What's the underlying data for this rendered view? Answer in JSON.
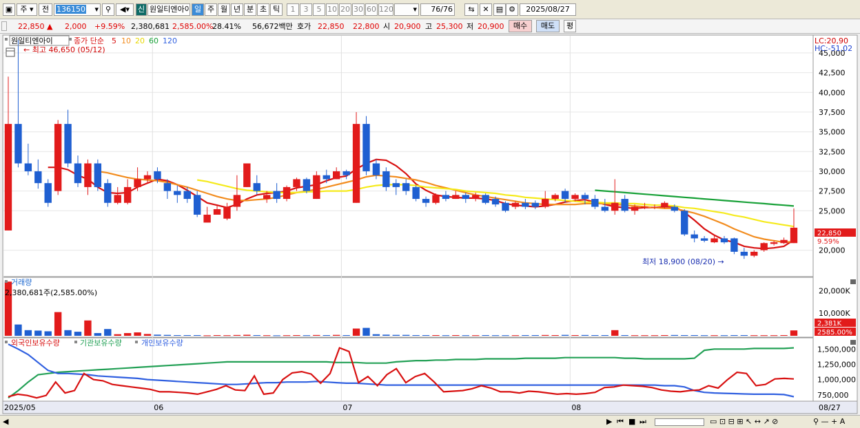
{
  "toolbar": {
    "period_type": "주",
    "prev_label": "전",
    "code": "136150",
    "badge_label": "신",
    "stock_name": "원일티엔아이",
    "periods": [
      "일",
      "주",
      "월",
      "년",
      "분",
      "초",
      "틱"
    ],
    "active_period": "일",
    "intervals": [
      "1",
      "3",
      "5",
      "10",
      "20",
      "30",
      "60",
      "120"
    ],
    "count": "76",
    "count_total": "/76",
    "date": "2025/08/27"
  },
  "quote": {
    "price": "22,850",
    "change": "2,000",
    "change_pct": "+9.59%",
    "volume": "2,380,681",
    "volume_pct": "2,585.00%",
    "turnover_pct": "28.41%",
    "amount": "56,672백만",
    "hoga_label": "호가",
    "ask": "22,850",
    "bid": "22,800",
    "open_label": "시",
    "open": "20,900",
    "high_label": "고",
    "high": "25,300",
    "low_label": "저",
    "low": "20,900",
    "buy_label": "매수",
    "sell_label": "매도",
    "avg_label": "평"
  },
  "price_panel": {
    "legend_name": "원일티엔아이",
    "ma_label": "종가 단순",
    "ma_periods": [
      "5",
      "10",
      "20",
      "60",
      "120"
    ],
    "max_note": "최고 46,650 (05/12)",
    "min_note": "최저 18,900 (08/20)",
    "lc": "LC:20,90",
    "hc": "HC:-51,02",
    "last_price_tag": "22,850",
    "last_pct_tag": "9.59%",
    "y_ticks": [
      "45,000",
      "42,500",
      "40,000",
      "37,500",
      "35,000",
      "32,500",
      "30,000",
      "27,500",
      "25,000",
      "20,000"
    ]
  },
  "volume_panel": {
    "title": "거래량",
    "info": "2,380,681주(2,585.00%)",
    "y_ticks": [
      "20,000K",
      "10,000K"
    ],
    "last_tag": "2,381K",
    "last_pct": "2585.00%"
  },
  "holding_panel": {
    "series_labels": [
      "외국인보유수량",
      "기관보유수량",
      "개인보유수량"
    ],
    "y_ticks": [
      "1,500,000",
      "1,250,000",
      "1,000,000",
      "750,000"
    ]
  },
  "x_labels": [
    "2025/05",
    "06",
    "07",
    "08",
    "08/27"
  ],
  "colors": {
    "up": "#e21b1b",
    "down": "#1f5fd1",
    "ma5": "#d81010",
    "ma10": "#f28c1e",
    "ma20": "#f5ea1a",
    "ma60": "#16a036",
    "foreign": "#d81010",
    "institution": "#22a055",
    "individual": "#2f5fe0"
  },
  "chart_data": {
    "type": "candlestick",
    "price_range": [
      17000,
      47000
    ],
    "volume_range": [
      0,
      25000
    ],
    "volume_unit": "K",
    "holding_range": [
      680000,
      1650000
    ],
    "candles": [
      [
        22500,
        36000,
        42000,
        22500
      ],
      [
        36000,
        31000,
        46650,
        30500
      ],
      [
        31000,
        30000,
        33500,
        29500
      ],
      [
        30000,
        28500,
        31500,
        27800
      ],
      [
        28500,
        26000,
        29000,
        25500
      ],
      [
        27500,
        36000,
        36500,
        27000
      ],
      [
        36000,
        31000,
        37800,
        30500
      ],
      [
        31000,
        28500,
        32000,
        28000
      ],
      [
        28000,
        31000,
        31500,
        27000
      ],
      [
        31000,
        28000,
        31500,
        27500
      ],
      [
        28500,
        26000,
        29000,
        25500
      ],
      [
        26000,
        27000,
        28000,
        25800
      ],
      [
        26000,
        28000,
        29000,
        25800
      ],
      [
        28000,
        29000,
        30500,
        27500
      ],
      [
        29000,
        29500,
        30000,
        28500
      ],
      [
        30000,
        29000,
        30500,
        28500
      ],
      [
        28500,
        27500,
        29000,
        26500
      ],
      [
        27500,
        27000,
        28200,
        26000
      ],
      [
        27500,
        26500,
        28000,
        26000
      ],
      [
        27000,
        24500,
        27500,
        24200
      ],
      [
        23500,
        24500,
        25500,
        23500
      ],
      [
        24500,
        25200,
        25800,
        24500
      ],
      [
        24000,
        25500,
        26000,
        23800
      ],
      [
        25500,
        27000,
        29500,
        25000
      ],
      [
        28000,
        31000,
        31000,
        28000
      ],
      [
        28500,
        27500,
        29500,
        27000
      ],
      [
        26500,
        27000,
        27500,
        26000
      ],
      [
        27500,
        26500,
        28500,
        26000
      ],
      [
        26500,
        28000,
        28200,
        26200
      ],
      [
        28000,
        29000,
        29200,
        27500
      ],
      [
        29000,
        27500,
        29200,
        27200
      ],
      [
        26500,
        29500,
        30000,
        26500
      ],
      [
        29500,
        29000,
        30200,
        28500
      ],
      [
        29000,
        30000,
        30500,
        29000
      ],
      [
        30000,
        29500,
        30200,
        29000
      ],
      [
        26000,
        36000,
        37500,
        26000
      ],
      [
        36000,
        30000,
        37000,
        29500
      ],
      [
        31000,
        29500,
        31500,
        29000
      ],
      [
        30000,
        28000,
        30500,
        27500
      ],
      [
        28500,
        28000,
        29000,
        27000
      ],
      [
        28500,
        27500,
        29000,
        27000
      ],
      [
        28000,
        26500,
        28200,
        26200
      ],
      [
        26500,
        26000,
        26800,
        25500
      ],
      [
        26000,
        27000,
        27200,
        25800
      ],
      [
        27000,
        26500,
        27500,
        26200
      ],
      [
        26500,
        27000,
        27500,
        26500
      ],
      [
        27000,
        26500,
        27300,
        26000
      ],
      [
        26500,
        27000,
        27300,
        26200
      ],
      [
        27000,
        26000,
        27200,
        25800
      ],
      [
        26500,
        25800,
        26800,
        25500
      ],
      [
        26000,
        25000,
        26200,
        24800
      ],
      [
        25500,
        26000,
        26200,
        25200
      ],
      [
        26000,
        25500,
        26500,
        25200
      ],
      [
        26000,
        25500,
        26300,
        25200
      ],
      [
        25500,
        26500,
        27500,
        25300
      ],
      [
        26500,
        27000,
        27200,
        26200
      ],
      [
        27500,
        26500,
        27800,
        26000
      ],
      [
        26500,
        27000,
        27200,
        26200
      ],
      [
        27000,
        26500,
        27300,
        25800
      ],
      [
        26500,
        25500,
        27000,
        25200
      ],
      [
        25500,
        25000,
        26500,
        24800
      ],
      [
        25000,
        26000,
        29000,
        24500
      ],
      [
        26500,
        25000,
        27000,
        24800
      ],
      [
        25000,
        25500,
        25800,
        24500
      ],
      [
        25500,
        25500,
        26000,
        25200
      ],
      [
        25500,
        25500,
        25800,
        25200
      ],
      [
        25500,
        26000,
        26200,
        25300
      ],
      [
        25500,
        25000,
        25800,
        24800
      ],
      [
        25000,
        22000,
        25200,
        21800
      ],
      [
        22000,
        21500,
        22500,
        21000
      ],
      [
        21500,
        21200,
        21800,
        21000
      ],
      [
        21000,
        21500,
        21800,
        20900
      ],
      [
        21500,
        21000,
        21800,
        20800
      ],
      [
        21500,
        19800,
        21600,
        19500
      ],
      [
        19800,
        19300,
        20300,
        18900
      ],
      [
        19300,
        19800,
        20000,
        19100
      ],
      [
        20000,
        20900,
        21000,
        19800
      ],
      [
        20800,
        21000,
        21200,
        20600
      ],
      [
        20900,
        21300,
        21600,
        20800
      ],
      [
        20900,
        22850,
        25300,
        20900
      ]
    ],
    "ma": {
      "5": [
        null,
        null,
        null,
        null,
        30500,
        30500,
        30200,
        29500,
        29000,
        28000,
        27300,
        27200,
        27300,
        28000,
        28500,
        29000,
        28800,
        28300,
        27600,
        26800,
        26000,
        25700,
        25400,
        25800,
        26500,
        27000,
        27200,
        27300,
        27500,
        27900,
        28100,
        28300,
        28800,
        29200,
        29400,
        30300,
        31000,
        31500,
        31400,
        30700,
        29700,
        28400,
        27600,
        27000,
        26800,
        26700,
        26600,
        26600,
        26500,
        26300,
        25900,
        25700,
        25600,
        25500,
        25600,
        25800,
        26100,
        26300,
        26400,
        26100,
        25800,
        25500,
        25400,
        25300,
        25400,
        25400,
        25500,
        25500,
        24800,
        23800,
        22700,
        21900,
        21300,
        21000,
        20500,
        20300,
        20200,
        20300,
        20500,
        21300
      ],
      "10": [
        null,
        null,
        null,
        null,
        null,
        null,
        null,
        null,
        null,
        30000,
        29800,
        29500,
        29200,
        29000,
        28900,
        28800,
        28600,
        28300,
        28000,
        27600,
        27200,
        26800,
        26500,
        26300,
        26300,
        26400,
        26500,
        26700,
        27000,
        27300,
        27500,
        27700,
        28000,
        28300,
        28600,
        28900,
        29300,
        29500,
        29400,
        29300,
        29100,
        28900,
        28600,
        28200,
        27900,
        27600,
        27300,
        27000,
        26800,
        26600,
        26400,
        26200,
        26000,
        25900,
        25800,
        25800,
        25800,
        25800,
        25900,
        25900,
        25900,
        25800,
        25700,
        25600,
        25500,
        25400,
        25300,
        25300,
        25000,
        24700,
        24300,
        23800,
        23300,
        22700,
        22200,
        21700,
        21400,
        21200,
        21000,
        21100
      ],
      "20": [
        null,
        null,
        null,
        null,
        null,
        null,
        null,
        null,
        null,
        null,
        null,
        null,
        null,
        null,
        null,
        null,
        null,
        null,
        null,
        28900,
        28700,
        28400,
        28100,
        27800,
        27600,
        27500,
        27400,
        27300,
        27300,
        27300,
        27400,
        27400,
        27500,
        27500,
        27500,
        27700,
        28000,
        28200,
        28300,
        28300,
        28300,
        28200,
        28000,
        27900,
        27800,
        27700,
        27500,
        27400,
        27300,
        27200,
        27000,
        26900,
        26700,
        26600,
        26500,
        26400,
        26300,
        26200,
        26100,
        26100,
        26000,
        26000,
        25900,
        25900,
        25800,
        25700,
        25700,
        25600,
        25400,
        25300,
        25100,
        24900,
        24700,
        24400,
        24200,
        23900,
        23600,
        23400,
        23200,
        23000
      ],
      "60": [
        null,
        null,
        null,
        null,
        null,
        null,
        null,
        null,
        null,
        null,
        null,
        null,
        null,
        null,
        null,
        null,
        null,
        null,
        null,
        null,
        null,
        null,
        null,
        null,
        null,
        null,
        null,
        null,
        null,
        null,
        null,
        null,
        null,
        null,
        null,
        null,
        null,
        null,
        null,
        null,
        null,
        null,
        null,
        null,
        null,
        null,
        null,
        null,
        null,
        null,
        null,
        null,
        null,
        null,
        null,
        null,
        null,
        null,
        null,
        27600,
        27500,
        27400,
        27300,
        27200,
        27100,
        27000,
        26900,
        26800,
        26700,
        26600,
        26500,
        26400,
        26300,
        26200,
        26100,
        26000,
        25900,
        25800,
        25700,
        25600
      ]
    },
    "volume": [
      24000,
      5000,
      2500,
      2300,
      2000,
      10500,
      2500,
      1800,
      6800,
      1200,
      3000,
      700,
      1200,
      1500,
      800,
      500,
      400,
      300,
      300,
      300,
      200,
      300,
      250,
      350,
      450,
      300,
      250,
      200,
      250,
      300,
      250,
      350,
      300,
      400,
      300,
      3200,
      3500,
      700,
      500,
      400,
      400,
      300,
      300,
      300,
      250,
      300,
      250,
      250,
      300,
      250,
      250,
      250,
      300,
      300,
      350,
      300,
      400,
      300,
      350,
      300,
      300,
      2500,
      300,
      250,
      250,
      250,
      300,
      350,
      300,
      300,
      250,
      250,
      250,
      300,
      300,
      250,
      250,
      250,
      300,
      2381
    ],
    "foreign": [
      720000,
      760000,
      740000,
      700000,
      740000,
      960000,
      780000,
      820000,
      1100000,
      1000000,
      980000,
      920000,
      900000,
      880000,
      860000,
      840000,
      800000,
      800000,
      790000,
      780000,
      760000,
      800000,
      840000,
      900000,
      830000,
      820000,
      1060000,
      760000,
      780000,
      1000000,
      1110000,
      1130000,
      1090000,
      940000,
      1100000,
      1520000,
      1460000,
      950000,
      1050000,
      900000,
      1080000,
      1180000,
      950000,
      1050000,
      1100000,
      960000,
      800000,
      810000,
      820000,
      850000,
      900000,
      860000,
      800000,
      800000,
      780000,
      810000,
      800000,
      780000,
      760000,
      770000,
      760000,
      770000,
      790000,
      870000,
      880000,
      910000,
      900000,
      890000,
      870000,
      830000,
      810000,
      800000,
      820000,
      830000,
      900000,
      860000,
      1000000,
      1120000,
      1100000,
      900000,
      920000,
      1010000,
      1020000,
      1010000
    ],
    "institution": [
      700000,
      820000,
      960000,
      1080000,
      1100000,
      1120000,
      1130000,
      1140000,
      1150000,
      1160000,
      1170000,
      1180000,
      1190000,
      1200000,
      1210000,
      1220000,
      1230000,
      1240000,
      1250000,
      1260000,
      1270000,
      1280000,
      1290000,
      1290000,
      1290000,
      1290000,
      1290000,
      1290000,
      1290000,
      1290000,
      1290000,
      1290000,
      1290000,
      1280000,
      1280000,
      1280000,
      1270000,
      1270000,
      1270000,
      1290000,
      1300000,
      1310000,
      1310000,
      1320000,
      1320000,
      1330000,
      1330000,
      1330000,
      1340000,
      1340000,
      1340000,
      1340000,
      1350000,
      1350000,
      1350000,
      1350000,
      1360000,
      1360000,
      1360000,
      1360000,
      1360000,
      1360000,
      1350000,
      1350000,
      1340000,
      1340000,
      1340000,
      1340000,
      1340000,
      1350000,
      1480000,
      1500000,
      1500000,
      1500000,
      1500000,
      1510000,
      1510000,
      1510000,
      1510000,
      1520000
    ],
    "individual": [
      1580000,
      1500000,
      1410000,
      1280000,
      1150000,
      1100000,
      1100000,
      1090000,
      1080000,
      1060000,
      1050000,
      1040000,
      1030000,
      1020000,
      1000000,
      990000,
      980000,
      970000,
      960000,
      950000,
      940000,
      930000,
      920000,
      920000,
      930000,
      940000,
      950000,
      950000,
      960000,
      960000,
      960000,
      970000,
      960000,
      950000,
      940000,
      940000,
      930000,
      920000,
      910000,
      910000,
      910000,
      910000,
      910000,
      910000,
      910000,
      910000,
      910000,
      910000,
      910000,
      910000,
      910000,
      910000,
      910000,
      910000,
      910000,
      910000,
      910000,
      910000,
      910000,
      910000,
      910000,
      910000,
      910000,
      910000,
      910000,
      910000,
      900000,
      900000,
      880000,
      820000,
      790000,
      780000,
      775000,
      770000,
      765000,
      760000,
      760000,
      760000,
      755000,
      720000
    ]
  }
}
